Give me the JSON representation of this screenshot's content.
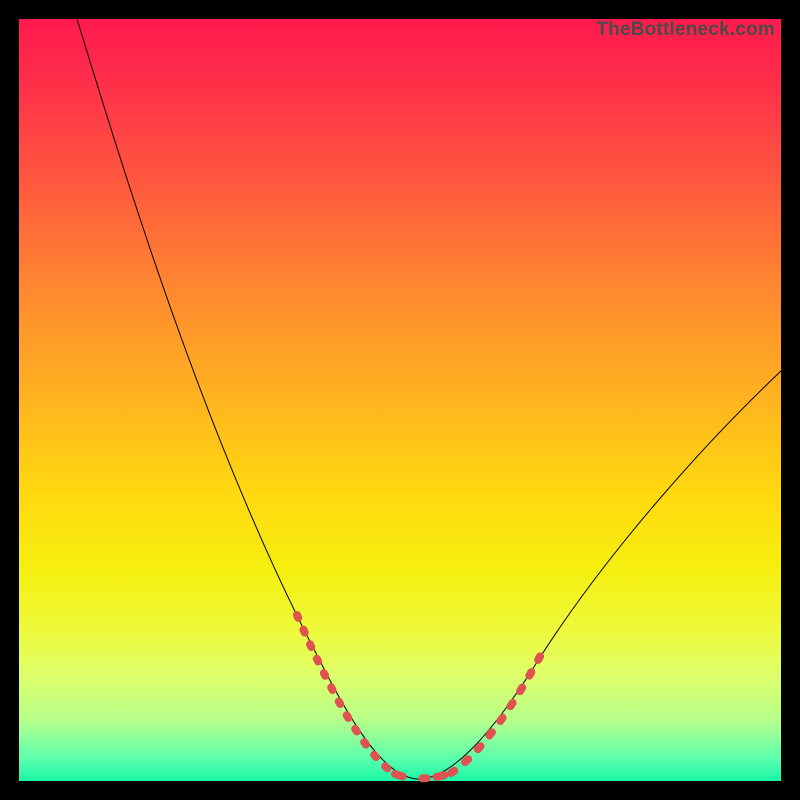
{
  "watermark": "TheBottleneck.com",
  "chart_data": {
    "type": "line",
    "title": "",
    "xlabel": "",
    "ylabel": "",
    "xlim": [
      0,
      100
    ],
    "ylim": [
      0,
      100
    ],
    "grid": false,
    "series": [
      {
        "name": "bottleneck-curve",
        "x": [
          10,
          15,
          20,
          25,
          30,
          35,
          40,
          45,
          48,
          50,
          52,
          55,
          60,
          65,
          70,
          75,
          80,
          85,
          90,
          95,
          100
        ],
        "y": [
          100,
          88,
          76,
          64,
          52,
          40,
          28,
          12,
          4,
          1,
          0,
          1,
          4,
          10,
          18,
          26,
          34,
          41,
          47,
          52,
          56
        ]
      }
    ],
    "highlight": {
      "name": "optimal-range-markers",
      "x": [
        38,
        40,
        42,
        44,
        46,
        48,
        50,
        52,
        54,
        56,
        58,
        60,
        62,
        64,
        66
      ],
      "y": [
        30,
        24,
        18,
        12,
        6,
        2,
        0,
        0,
        1,
        3,
        6,
        10,
        14,
        19,
        24
      ],
      "style": "dotted"
    },
    "colors": {
      "curve": "#000000",
      "highlight": "#e0524f",
      "gradient_top": "#ff1a4d",
      "gradient_mid": "#ffd80f",
      "gradient_bottom": "#18f7a8"
    }
  }
}
